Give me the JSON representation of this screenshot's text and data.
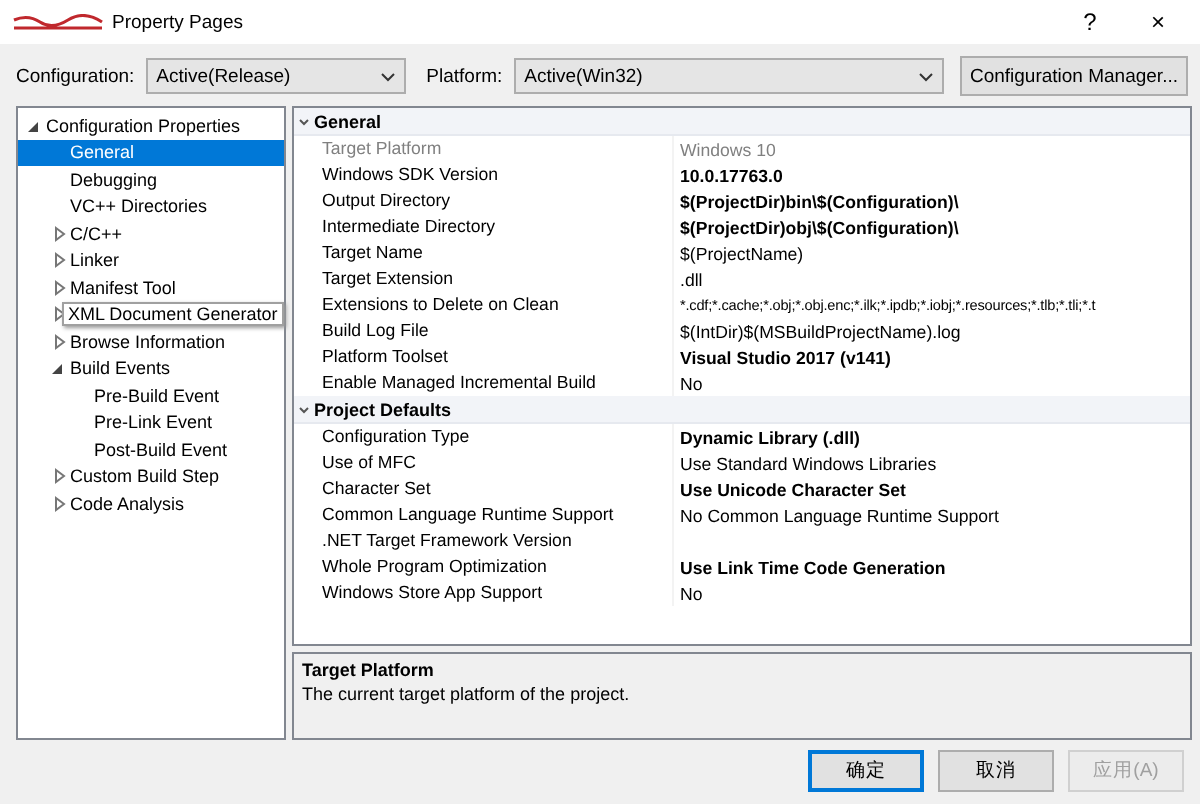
{
  "window": {
    "redacted": true,
    "title": "Property Pages",
    "help": "?",
    "close": "×"
  },
  "toolbar": {
    "configuration_label": "Configuration:",
    "configuration": "Active(Release)",
    "platform_label": "Platform:",
    "platform": "Active(Win32)",
    "manager_button": "Configuration Manager..."
  },
  "tree": [
    {
      "label": "Configuration Properties",
      "expanded": true,
      "selected": false,
      "children": [
        {
          "label": "General",
          "selected": true
        },
        {
          "label": "Debugging",
          "selected": false
        },
        {
          "label": "VC++ Directories",
          "selected": false
        },
        {
          "label": "C/C++",
          "expanded": false,
          "selected": false
        },
        {
          "label": "Linker",
          "expanded": false,
          "selected": false
        },
        {
          "label": "Manifest Tool",
          "expanded": false,
          "selected": false
        },
        {
          "label": "XML Document Generator",
          "expanded": false,
          "selected": false,
          "tooltip": true
        },
        {
          "label": "Browse Information",
          "expanded": false,
          "selected": false
        },
        {
          "label": "Build Events",
          "expanded": true,
          "selected": false,
          "children": [
            {
              "label": "Pre-Build Event",
              "selected": false
            },
            {
              "label": "Pre-Link Event",
              "selected": false
            },
            {
              "label": "Post-Build Event",
              "selected": false
            }
          ]
        },
        {
          "label": "Custom Build Step",
          "expanded": false,
          "selected": false
        },
        {
          "label": "Code Analysis",
          "expanded": false,
          "selected": false
        }
      ]
    }
  ],
  "grid": [
    {
      "title": "General",
      "expanded": true,
      "rows": [
        {
          "name": "Target Platform",
          "value": "Windows 10",
          "modified": false,
          "disabled": true
        },
        {
          "name": "Windows SDK Version",
          "value": "10.0.17763.0",
          "modified": true,
          "disabled": false
        },
        {
          "name": "Output Directory",
          "value": "$(ProjectDir)bin\\$(Configuration)\\",
          "modified": true,
          "disabled": false
        },
        {
          "name": "Intermediate Directory",
          "value": "$(ProjectDir)obj\\$(Configuration)\\",
          "modified": true,
          "disabled": false
        },
        {
          "name": "Target Name",
          "value": "$(ProjectName)",
          "modified": false,
          "disabled": false
        },
        {
          "name": "Target Extension",
          "value": ".dll",
          "modified": false,
          "disabled": false
        },
        {
          "name": "Extensions to Delete on Clean",
          "value": "*.cdf;*.cache;*.obj;*.obj.enc;*.ilk;*.ipdb;*.iobj;*.resources;*.tlb;*.tli;*.t",
          "modified": false,
          "disabled": false
        },
        {
          "name": "Build Log File",
          "value": "$(IntDir)$(MSBuildProjectName).log",
          "modified": false,
          "disabled": false
        },
        {
          "name": "Platform Toolset",
          "value": "Visual Studio 2017 (v141)",
          "modified": true,
          "disabled": false
        },
        {
          "name": "Enable Managed Incremental Build",
          "value": "No",
          "modified": false,
          "disabled": false
        }
      ]
    },
    {
      "title": "Project Defaults",
      "expanded": true,
      "rows": [
        {
          "name": "Configuration Type",
          "value": "Dynamic Library (.dll)",
          "modified": true,
          "disabled": false
        },
        {
          "name": "Use of MFC",
          "value": "Use Standard Windows Libraries",
          "modified": false,
          "disabled": false
        },
        {
          "name": "Character Set",
          "value": "Use Unicode Character Set",
          "modified": true,
          "disabled": false
        },
        {
          "name": "Common Language Runtime Support",
          "value": "No Common Language Runtime Support",
          "modified": false,
          "disabled": false
        },
        {
          "name": ".NET Target Framework Version",
          "disabled": false
        },
        {
          "name": "Whole Program Optimization",
          "value": "Use Link Time Code Generation",
          "modified": true,
          "disabled": false
        },
        {
          "name": "Windows Store App Support",
          "value": "No",
          "modified": false,
          "disabled": false
        }
      ]
    }
  ],
  "description": {
    "title": "Target Platform",
    "text": "The current target platform of the project."
  },
  "buttons": [
    {
      "label": "确定",
      "kind": "default",
      "disabled": false
    },
    {
      "label": "取消",
      "kind": "normal",
      "disabled": false
    },
    {
      "label": "应用(A)",
      "kind": "normal",
      "disabled": true
    }
  ]
}
